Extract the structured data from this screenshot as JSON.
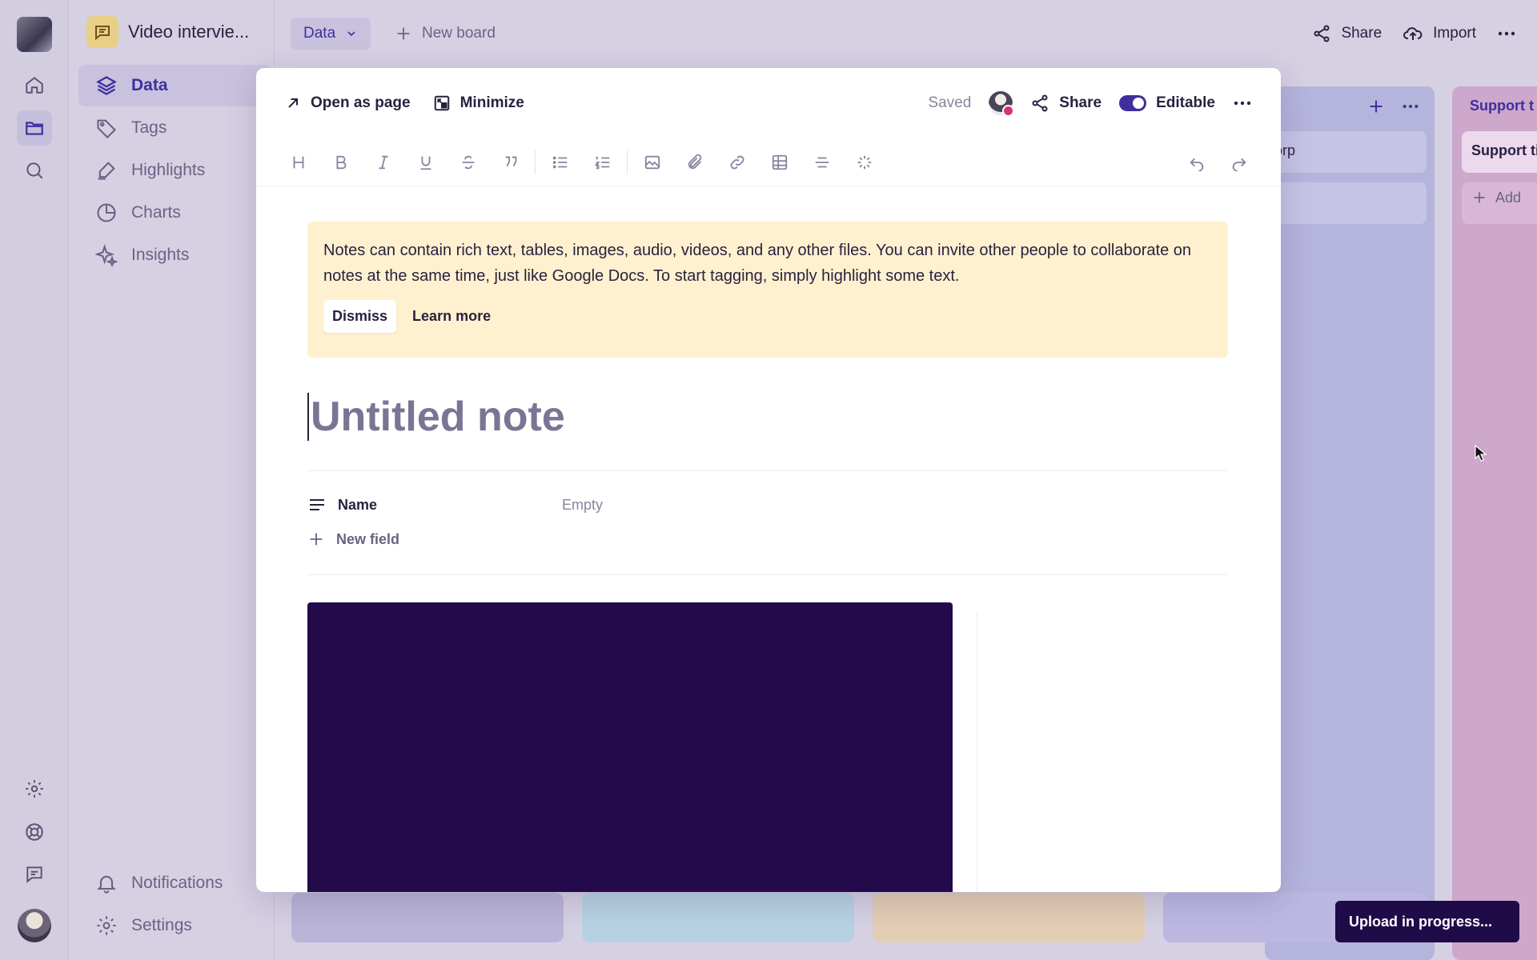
{
  "project": {
    "name": "Video intervie..."
  },
  "nav": {
    "items": [
      {
        "label": "Data",
        "icon": "layers-icon",
        "active": true
      },
      {
        "label": "Tags",
        "icon": "tag-icon",
        "active": false
      },
      {
        "label": "Highlights",
        "icon": "highlighter-icon",
        "active": false
      },
      {
        "label": "Charts",
        "icon": "pie-chart-icon",
        "active": false
      },
      {
        "label": "Insights",
        "icon": "sparkles-icon",
        "active": false
      }
    ],
    "bottom": [
      {
        "label": "Notifications",
        "icon": "bell-icon"
      },
      {
        "label": "Settings",
        "icon": "gear-icon"
      }
    ]
  },
  "topbar": {
    "board_select": "Data",
    "new_board": "New board",
    "share": "Share",
    "import": "Import"
  },
  "board": {
    "column_b_header": "Support t",
    "card_a1": "orp",
    "card_b1": "Support ti",
    "add_label": "Add"
  },
  "modal": {
    "open_as_page": "Open as page",
    "minimize": "Minimize",
    "saved": "Saved",
    "share": "Share",
    "editable": "Editable",
    "notice": {
      "text": "Notes can contain rich text, tables, images, audio, videos, and any other files. You can invite other people to collaborate on notes at the same time, just like Google Docs. To start tagging, simply highlight some text.",
      "dismiss": "Dismiss",
      "learn_more": "Learn more"
    },
    "title_placeholder": "Untitled note",
    "fields": [
      {
        "name": "Name",
        "value": "Empty"
      }
    ],
    "new_field": "New field"
  },
  "upload_status": "Upload in progress...",
  "colors": {
    "accent": "#3f2f9e",
    "notice_bg": "#fff1cf",
    "video_bg": "#220a4b",
    "toast_bg": "#1f0b47"
  }
}
